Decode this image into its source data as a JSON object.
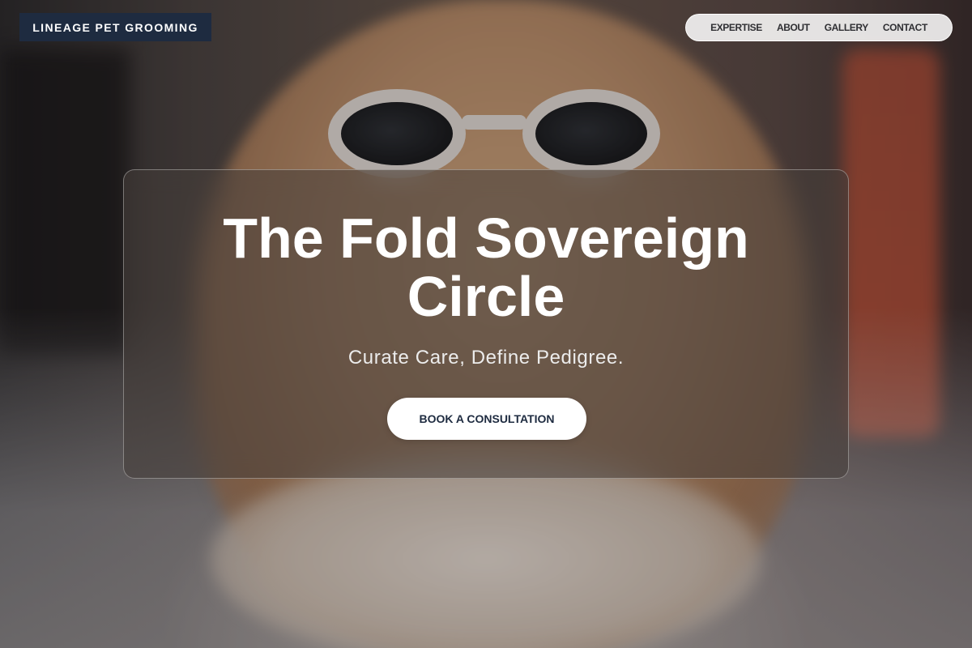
{
  "brand": {
    "name": "LINEAGE PET GROOMING"
  },
  "nav": {
    "items": [
      {
        "label": "EXPERTISE"
      },
      {
        "label": "ABOUT"
      },
      {
        "label": "GALLERY"
      },
      {
        "label": "CONTACT"
      }
    ]
  },
  "hero": {
    "title": "The Fold Sovereign Circle",
    "subtitle": "Curate Care, Define Pedigree.",
    "cta_label": "BOOK A CONSULTATION"
  },
  "colors": {
    "brand_bg": "#1e2b40",
    "cta_text": "#1e2b40",
    "accent_red": "#d9583a"
  }
}
